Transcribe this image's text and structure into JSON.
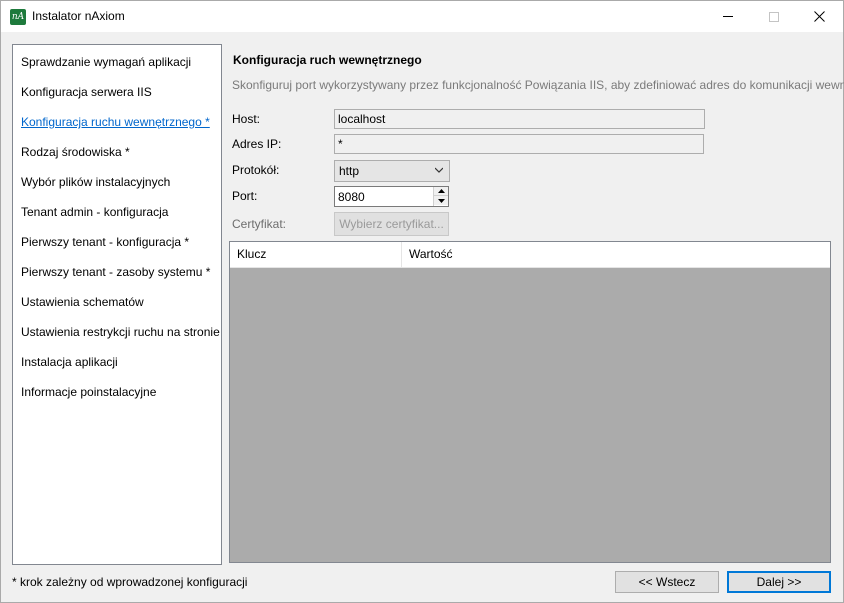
{
  "window": {
    "title": "Instalator nAxiom",
    "icon": "nA"
  },
  "sidebar": {
    "items": [
      {
        "label": "Sprawdzanie wymagań aplikacji"
      },
      {
        "label": "Konfiguracja serwera IIS"
      },
      {
        "label": "Konfiguracja ruchu wewnętrznego *"
      },
      {
        "label": "Rodzaj środowiska *"
      },
      {
        "label": "Wybór plików instalacyjnych"
      },
      {
        "label": "Tenant admin - konfiguracja"
      },
      {
        "label": "Pierwszy tenant - konfiguracja *"
      },
      {
        "label": "Pierwszy tenant - zasoby systemu *"
      },
      {
        "label": "Ustawienia schematów"
      },
      {
        "label": "Ustawienia restrykcji ruchu na stronie"
      },
      {
        "label": "Instalacja aplikacji"
      },
      {
        "label": "Informacje poinstalacyjne"
      }
    ],
    "active_index": 2
  },
  "main": {
    "heading": "Konfiguracja ruch wewnętrznego",
    "description": "Skonfiguruj port wykorzystywany przez funkcjonalność Powiązania IIS, aby zdefiniować adres do komunikacji wewnętrznej",
    "host_label": "Host:",
    "host_value": "localhost",
    "ip_label": "Adres IP:",
    "ip_value": "*",
    "protocol_label": "Protokół:",
    "protocol_value": "http",
    "port_label": "Port:",
    "port_value": "8080",
    "cert_label": "Certyfikat:",
    "cert_button": "Wybierz certyfikat..."
  },
  "grid": {
    "columns": [
      "Klucz",
      "Wartość"
    ]
  },
  "footer": {
    "note": "* krok zależny od wprowadzonej konfiguracji",
    "back_label": "<< Wstecz",
    "next_label": "Dalej >>"
  },
  "colors": {
    "active_link": "#0066cc",
    "app_icon": "#1e7a3c",
    "default_button_border": "#0078d7"
  }
}
